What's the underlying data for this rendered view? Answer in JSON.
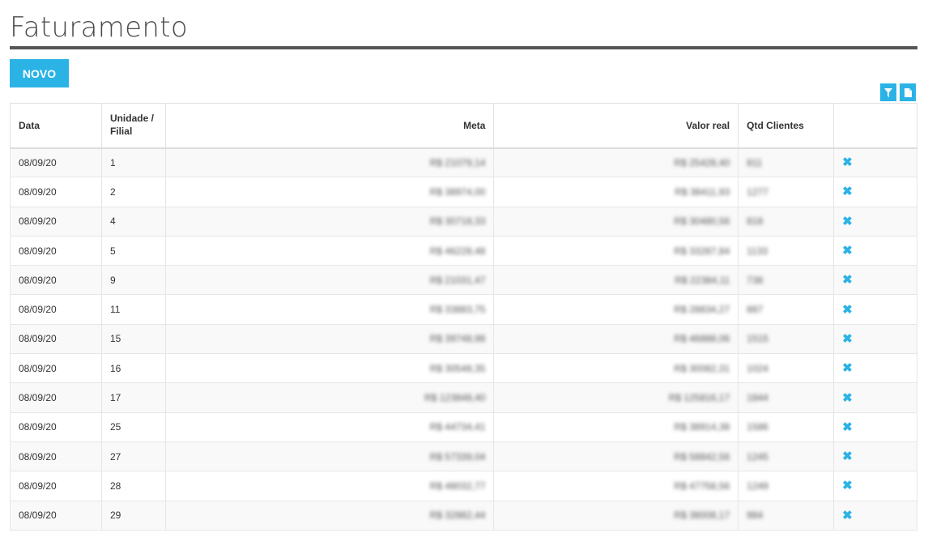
{
  "header": {
    "title": "Faturamento",
    "new_button": "NOVO"
  },
  "toolbar": {
    "filter_icon": "filter-icon",
    "export_icon": "document-icon"
  },
  "colors": {
    "accent": "#2bb3e6",
    "rule": "#555555"
  },
  "table": {
    "columns": [
      "Data",
      "Unidade / Filial",
      "Meta",
      "Valor real",
      "Qtd Clientes",
      ""
    ],
    "rows": [
      {
        "data": "08/09/20",
        "unidade": "1",
        "meta": "R$ 21079,14",
        "valor": "R$ 25428,40",
        "qtd": "811"
      },
      {
        "data": "08/09/20",
        "unidade": "2",
        "meta": "R$ 38974,00",
        "valor": "R$ 38411,93",
        "qtd": "1277"
      },
      {
        "data": "08/09/20",
        "unidade": "4",
        "meta": "R$ 30718,33",
        "valor": "R$ 30480,56",
        "qtd": "818"
      },
      {
        "data": "08/09/20",
        "unidade": "5",
        "meta": "R$ 46228,48",
        "valor": "R$ 33287,84",
        "qtd": "1133"
      },
      {
        "data": "08/09/20",
        "unidade": "9",
        "meta": "R$ 21031,47",
        "valor": "R$ 22384,11",
        "qtd": "738"
      },
      {
        "data": "08/09/20",
        "unidade": "11",
        "meta": "R$ 33883,75",
        "valor": "R$ 28834,27",
        "qtd": "887"
      },
      {
        "data": "08/09/20",
        "unidade": "15",
        "meta": "R$ 39748,98",
        "valor": "R$ 46888,06",
        "qtd": "1515"
      },
      {
        "data": "08/09/20",
        "unidade": "16",
        "meta": "R$ 30548,35",
        "valor": "R$ 30082,31",
        "qtd": "1024"
      },
      {
        "data": "08/09/20",
        "unidade": "17",
        "meta": "R$ 123848,40",
        "valor": "R$ 125816,17",
        "qtd": "1844"
      },
      {
        "data": "08/09/20",
        "unidade": "25",
        "meta": "R$ 44734,41",
        "valor": "R$ 38914,38",
        "qtd": "1586"
      },
      {
        "data": "08/09/20",
        "unidade": "27",
        "meta": "R$ 57339,04",
        "valor": "R$ 58842,56",
        "qtd": "1245"
      },
      {
        "data": "08/09/20",
        "unidade": "28",
        "meta": "R$ 48032,77",
        "valor": "R$ 47758,56",
        "qtd": "1249"
      },
      {
        "data": "08/09/20",
        "unidade": "29",
        "meta": "R$ 32882,44",
        "valor": "R$ 38008,17",
        "qtd": "984"
      }
    ],
    "row_action_icon": "close-icon"
  }
}
